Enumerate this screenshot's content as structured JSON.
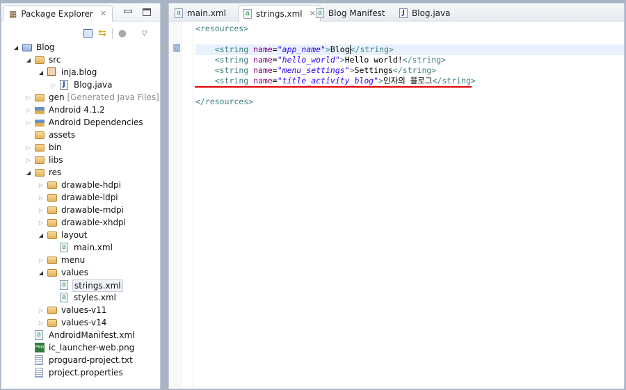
{
  "explorer": {
    "title": "Package Explorer",
    "tree": [
      {
        "level": 0,
        "state": "open",
        "icon": "project",
        "label": "Blog"
      },
      {
        "level": 1,
        "state": "open",
        "icon": "source-folder",
        "label": "src"
      },
      {
        "level": 2,
        "state": "open",
        "icon": "package",
        "label": "inja.blog"
      },
      {
        "level": 3,
        "state": "closed",
        "icon": "java-file",
        "label": "Blog.java"
      },
      {
        "level": 1,
        "state": "closed",
        "icon": "source-folder",
        "label": "gen",
        "decoration": "[Generated Java Files]"
      },
      {
        "level": 1,
        "state": "closed",
        "icon": "library",
        "label": "Android 4.1.2"
      },
      {
        "level": 1,
        "state": "closed",
        "icon": "library",
        "label": "Android Dependencies"
      },
      {
        "level": 1,
        "state": "none",
        "icon": "folder",
        "label": "assets"
      },
      {
        "level": 1,
        "state": "closed",
        "icon": "folder",
        "label": "bin"
      },
      {
        "level": 1,
        "state": "closed",
        "icon": "folder",
        "label": "libs"
      },
      {
        "level": 1,
        "state": "open",
        "icon": "folder",
        "label": "res"
      },
      {
        "level": 2,
        "state": "closed",
        "icon": "folder",
        "label": "drawable-hdpi"
      },
      {
        "level": 2,
        "state": "closed",
        "icon": "folder",
        "label": "drawable-ldpi"
      },
      {
        "level": 2,
        "state": "closed",
        "icon": "folder",
        "label": "drawable-mdpi"
      },
      {
        "level": 2,
        "state": "closed",
        "icon": "folder",
        "label": "drawable-xhdpi"
      },
      {
        "level": 2,
        "state": "open",
        "icon": "folder",
        "label": "layout"
      },
      {
        "level": 3,
        "state": "none",
        "icon": "xml-file",
        "label": "main.xml"
      },
      {
        "level": 2,
        "state": "closed",
        "icon": "folder",
        "label": "menu"
      },
      {
        "level": 2,
        "state": "open",
        "icon": "folder",
        "label": "values"
      },
      {
        "level": 3,
        "state": "none",
        "icon": "xml-file",
        "label": "strings.xml",
        "selected": true
      },
      {
        "level": 3,
        "state": "none",
        "icon": "xml-file",
        "label": "styles.xml"
      },
      {
        "level": 2,
        "state": "closed",
        "icon": "folder",
        "label": "values-v11"
      },
      {
        "level": 2,
        "state": "closed",
        "icon": "folder",
        "label": "values-v14"
      },
      {
        "level": 1,
        "state": "none",
        "icon": "xml-file",
        "label": "AndroidManifest.xml"
      },
      {
        "level": 1,
        "state": "none",
        "icon": "png-file",
        "label": "ic_launcher-web.png"
      },
      {
        "level": 1,
        "state": "none",
        "icon": "text-file",
        "label": "proguard-project.txt"
      },
      {
        "level": 1,
        "state": "none",
        "icon": "text-file",
        "label": "project.properties"
      }
    ]
  },
  "editor": {
    "tabs": [
      {
        "label": "main.xml",
        "icon": "xml-file"
      },
      {
        "label": "strings.xml",
        "icon": "xml-file",
        "active": true
      },
      {
        "label": "Blog Manifest",
        "icon": "xml-file"
      },
      {
        "label": "Blog.java",
        "icon": "java-file"
      }
    ],
    "open_tag": "<resources>",
    "close_tag": "</resources>",
    "strings": [
      {
        "name": "app_name",
        "value": "Blog"
      },
      {
        "name": "hello_world",
        "value": "Hello world!"
      },
      {
        "name": "menu_settings",
        "value": "Settings"
      },
      {
        "name": "title_activity_blog",
        "value": "인자의 블로그"
      }
    ]
  },
  "colors": {
    "tag": "#3f7f7f",
    "attr": "#7f007f",
    "value": "#2a00ff",
    "underline": "#e00000",
    "current_line": "#e8f2fe"
  }
}
